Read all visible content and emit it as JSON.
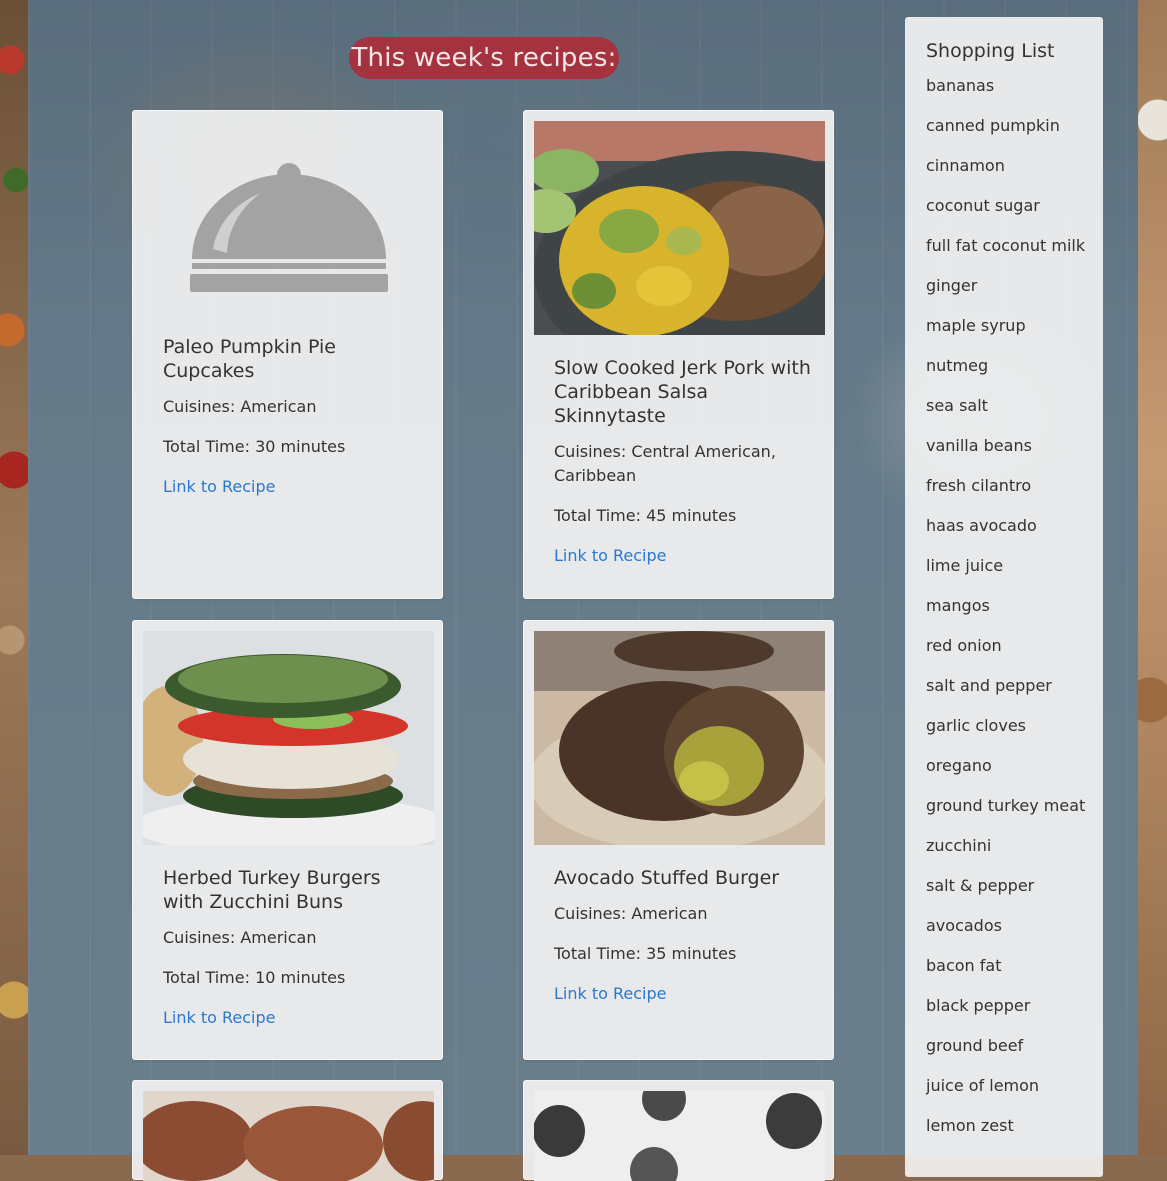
{
  "page": {
    "heading": "This week's recipes:",
    "accent_color": "#a4333f",
    "link_color": "#2b78d0"
  },
  "recipes": [
    {
      "title": "Paleo Pumpkin Pie Cupcakes",
      "cuisines": "Cuisines: American",
      "time": "Total Time: 30 minutes",
      "link": "Link to Recipe",
      "image": "cloche-placeholder-icon"
    },
    {
      "title": "Slow Cooked Jerk Pork with Caribbean Salsa Skinnytaste",
      "cuisines": "Cuisines: Central American, Caribbean",
      "time": "Total Time: 45 minutes",
      "link": "Link to Recipe",
      "image": "pork-salsa-photo"
    },
    {
      "title": "Herbed Turkey Burgers with Zucchini Buns",
      "cuisines": "Cuisines: American",
      "time": "Total Time: 10 minutes",
      "link": "Link to Recipe",
      "image": "turkey-burger-photo"
    },
    {
      "title": "Avocado Stuffed Burger",
      "cuisines": "Cuisines: American",
      "time": "Total Time: 35 minutes",
      "link": "Link to Recipe",
      "image": "stuffed-burger-photo"
    }
  ],
  "shopping_list": {
    "title": "Shopping List",
    "items": [
      "bananas",
      "canned pumpkin",
      "cinnamon",
      "coconut sugar",
      "full fat coconut milk",
      "ginger",
      "maple syrup",
      "nutmeg",
      "sea salt",
      "vanilla beans",
      "fresh cilantro",
      "haas avocado",
      "lime juice",
      "mangos",
      "red onion",
      "salt and pepper",
      "garlic cloves",
      "oregano",
      "ground turkey meat",
      "zucchini",
      "salt & pepper",
      "avocados",
      "bacon fat",
      "black pepper",
      "ground beef",
      "juice of lemon",
      "lemon zest"
    ]
  }
}
